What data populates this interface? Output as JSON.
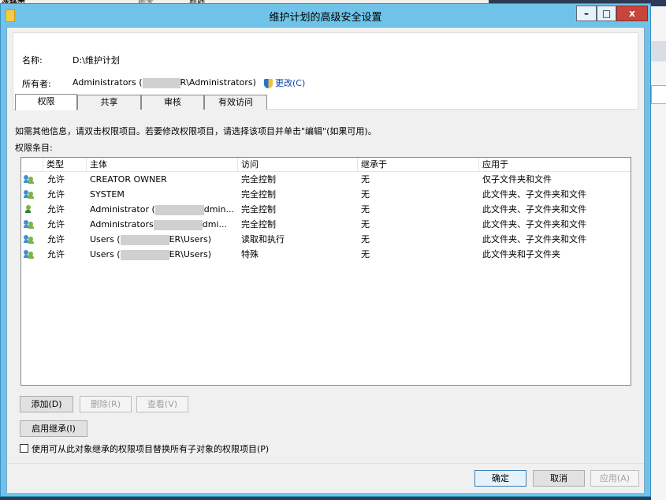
{
  "background": {
    "menu_items": [
      "选择类",
      "脚本",
      "帮助"
    ]
  },
  "window": {
    "title": "维护计划的高级安全设置",
    "min_glyph": "–",
    "max_glyph": "□",
    "close_glyph": "x"
  },
  "header": {
    "name_label": "名称:",
    "name_value": "D:\\维护计划",
    "owner_label": "所有者:",
    "owner_value_prefix": "Administrators (",
    "owner_value_suffix": "R\\Administrators)",
    "change_link": "更改(C)"
  },
  "tabs": [
    {
      "label": "权限",
      "active": true
    },
    {
      "label": "共享",
      "active": false
    },
    {
      "label": "审核",
      "active": false
    },
    {
      "label": "有效访问",
      "active": false
    }
  ],
  "info_text": "如需其他信息，请双击权限项目。若要修改权限项目，请选择该项目并单击\"编辑\"(如果可用)。",
  "entries_label": "权限条目:",
  "columns": [
    "类型",
    "主体",
    "访问",
    "继承于",
    "应用于"
  ],
  "rows": [
    {
      "type": "允许",
      "principal": "CREATOR OWNER",
      "masked": false,
      "principal_tail": "",
      "access": "完全控制",
      "inherited": "无",
      "applies": "仅子文件夹和文件",
      "icon": "group-icon"
    },
    {
      "type": "允许",
      "principal": "SYSTEM",
      "masked": false,
      "principal_tail": "",
      "access": "完全控制",
      "inherited": "无",
      "applies": "此文件夹、子文件夹和文件",
      "icon": "group-icon"
    },
    {
      "type": "允许",
      "principal": "Administrator (",
      "masked": true,
      "principal_tail": "dmin...",
      "access": "完全控制",
      "inherited": "无",
      "applies": "此文件夹、子文件夹和文件",
      "icon": "user-icon"
    },
    {
      "type": "允许",
      "principal": "Administrators",
      "masked": true,
      "principal_tail": "dmi...",
      "access": "完全控制",
      "inherited": "无",
      "applies": "此文件夹、子文件夹和文件",
      "icon": "group-icon"
    },
    {
      "type": "允许",
      "principal": "Users (",
      "masked": true,
      "principal_tail": "ER\\Users)",
      "access": "读取和执行",
      "inherited": "无",
      "applies": "此文件夹、子文件夹和文件",
      "icon": "group-icon"
    },
    {
      "type": "允许",
      "principal": "Users (",
      "masked": true,
      "principal_tail": "ER\\Users)",
      "access": "特殊",
      "inherited": "无",
      "applies": "此文件夹和子文件夹",
      "icon": "group-icon"
    }
  ],
  "buttons": {
    "add": "添加(D)",
    "remove": "删除(R)",
    "view": "查看(V)",
    "enable_inheritance": "启用继承(I)",
    "ok": "确定",
    "cancel": "取消",
    "apply": "应用(A)"
  },
  "replace_checkbox": {
    "label": "使用可从此对象继承的权限项目替换所有子对象的权限项目(P)",
    "checked": false
  },
  "colors": {
    "titlebar": "#6fc3e8",
    "close_button": "#c8453c",
    "link": "#0645ad"
  }
}
